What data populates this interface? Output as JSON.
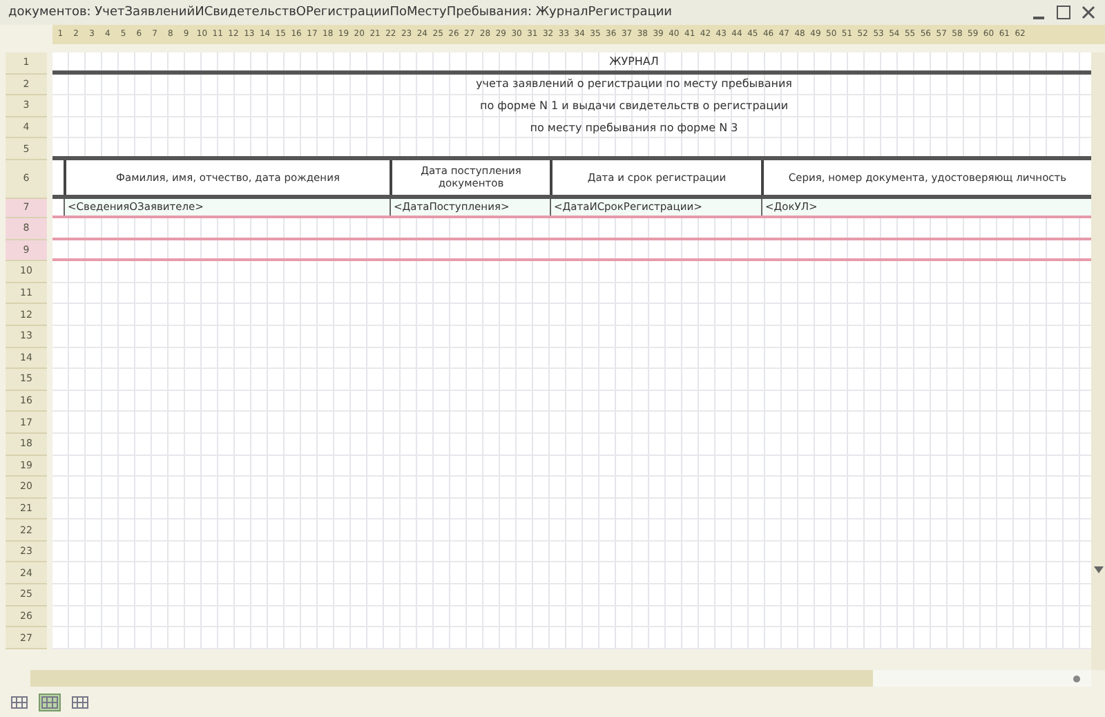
{
  "window": {
    "title": "документов: УчетЗаявленийИСвидетельствОРегистрацииПоМестуПребывания: ЖурналРегистрации"
  },
  "column_numbers": [
    "1",
    "2",
    "3",
    "4",
    "5",
    "6",
    "7",
    "8",
    "9",
    "10",
    "11",
    "12",
    "13",
    "14",
    "15",
    "16",
    "17",
    "18",
    "19",
    "20",
    "21",
    "22",
    "23",
    "24",
    "25",
    "26",
    "27",
    "28",
    "29",
    "30",
    "31",
    "32",
    "33",
    "34",
    "35",
    "36",
    "37",
    "38",
    "39",
    "40",
    "41",
    "42",
    "43",
    "44",
    "45",
    "46",
    "47",
    "48",
    "49",
    "50",
    "51",
    "52",
    "53",
    "54",
    "55",
    "56",
    "57",
    "58",
    "59",
    "60",
    "61",
    "62"
  ],
  "rows": [
    {
      "number": "1",
      "marked": false
    },
    {
      "number": "2",
      "marked": false
    },
    {
      "number": "3",
      "marked": false
    },
    {
      "number": "4",
      "marked": false
    },
    {
      "number": "5",
      "marked": false
    },
    {
      "number": "6",
      "marked": false
    },
    {
      "number": "7",
      "marked": true
    },
    {
      "number": "8",
      "marked": true
    },
    {
      "number": "9",
      "marked": true
    },
    {
      "number": "10",
      "marked": false
    },
    {
      "number": "11",
      "marked": false
    },
    {
      "number": "12",
      "marked": false
    },
    {
      "number": "13",
      "marked": false
    },
    {
      "number": "14",
      "marked": false
    },
    {
      "number": "15",
      "marked": false
    },
    {
      "number": "16",
      "marked": false
    },
    {
      "number": "17",
      "marked": false
    },
    {
      "number": "18",
      "marked": false
    },
    {
      "number": "19",
      "marked": false
    },
    {
      "number": "20",
      "marked": false
    },
    {
      "number": "21",
      "marked": false
    },
    {
      "number": "22",
      "marked": false
    },
    {
      "number": "23",
      "marked": false
    },
    {
      "number": "24",
      "marked": false
    },
    {
      "number": "25",
      "marked": false
    },
    {
      "number": "26",
      "marked": false
    },
    {
      "number": "27",
      "marked": false
    }
  ],
  "heading": {
    "title": "ЖУРНАЛ",
    "lines": [
      "учета заявлений о регистрации по месту пребывания",
      "по форме N 1 и выдачи свидетельств о регистрации",
      "по месту пребывания по форме N 3"
    ]
  },
  "table": {
    "columns": [
      "Фамилия, имя, отчество, дата рождения",
      "Дата поступления документов",
      "Дата и срок регистрации",
      "Серия, номер документа, удостоверяющ личность"
    ],
    "template_row": [
      "<СведенияОЗаявителе>",
      "<ДатаПоступления>",
      "<ДатаИСрокРегистрации>",
      "<ДокУЛ>"
    ]
  },
  "view_buttons": [
    {
      "selected": false
    },
    {
      "selected": true
    },
    {
      "selected": false
    }
  ]
}
